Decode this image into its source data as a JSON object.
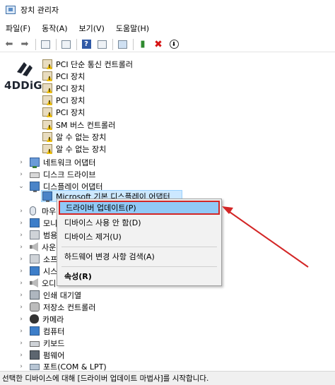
{
  "window": {
    "title": "장치 관리자"
  },
  "menu": [
    "파일(F)",
    "동작(A)",
    "보기(V)",
    "도움말(H)"
  ],
  "toolbar_icons": [
    "back-arrow-icon",
    "forward-arrow-icon",
    "properties-icon",
    "view-icon",
    "help-icon",
    "scan-icon",
    "add-driver-icon",
    "uninstall-icon",
    "download-icon"
  ],
  "logo": {
    "text": "4DDiG"
  },
  "tree": {
    "sub_items": [
      "PCI 단순 통신 컨트롤러",
      "PCI 장치",
      "PCI 장치",
      "PCI 장치",
      "PCI 장치",
      "SM 버스 컨트롤러",
      "알 수 없는 장치",
      "알 수 없는 장치"
    ],
    "categories_top": [
      {
        "label": "네트워크 어댑터",
        "icon": "network-adapter-icon",
        "expanded": false
      },
      {
        "label": "디스크 드라이브",
        "icon": "disk-drive-icon",
        "expanded": false
      },
      {
        "label": "디스플레이 어댑터",
        "icon": "display-adapter-icon",
        "expanded": true
      }
    ],
    "display_child": "Microsoft 기본 디스플레이 어댑터",
    "partial_categories": [
      "마우",
      "모니",
      "범용",
      "사운",
      "소프",
      "시스",
      "오디"
    ],
    "categories_bottom": [
      {
        "label": "인쇄 대기열",
        "icon": "print-queue-icon"
      },
      {
        "label": "저장소 컨트롤러",
        "icon": "storage-controller-icon"
      },
      {
        "label": "카메라",
        "icon": "camera-icon"
      },
      {
        "label": "컴퓨터",
        "icon": "computer-icon"
      },
      {
        "label": "키보드",
        "icon": "keyboard-icon"
      },
      {
        "label": "펌웨어",
        "icon": "firmware-icon"
      },
      {
        "label": "포트(COM & LPT)",
        "icon": "port-icon"
      }
    ]
  },
  "context_menu": {
    "update_driver": "드라이버 업데이트(P)",
    "disable_device": "디바이스 사용 안 함(D)",
    "uninstall_device": "디바이스 제거(U)",
    "scan_hardware": "하드웨어 변경 사항 검색(A)",
    "properties": "속성(R)"
  },
  "status": {
    "text": "선택한 디바이스에 대해 [드라이버 업데이트 마법사]를 시작합니다."
  },
  "colors": {
    "highlight_border": "#d32626",
    "menu_highlight": "#91c9f7",
    "selection": "#cce8ff",
    "annotation_arrow": "#d32626"
  }
}
